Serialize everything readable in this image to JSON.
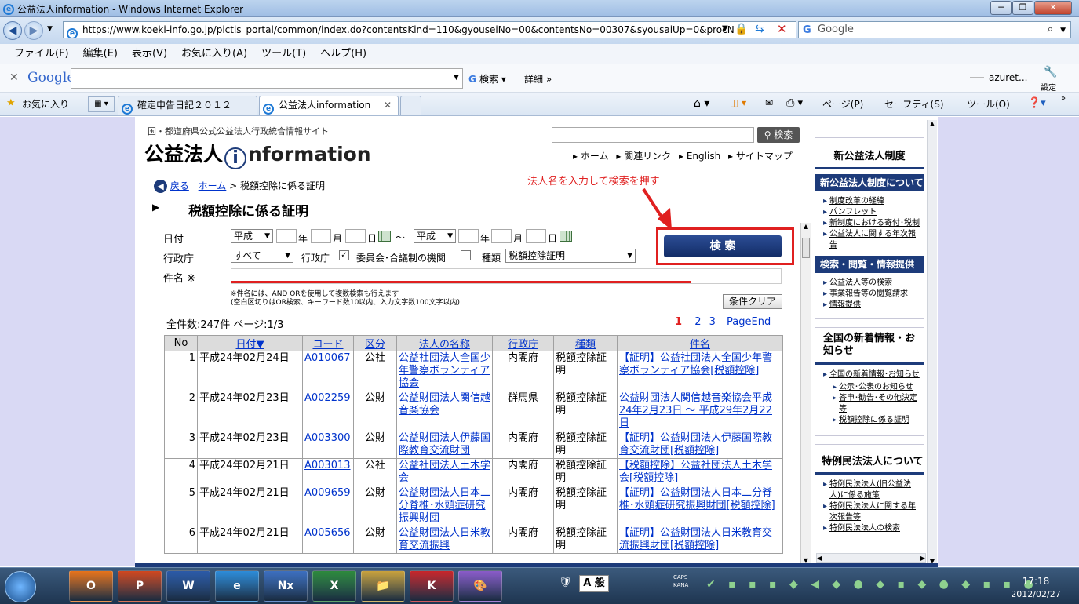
{
  "window": {
    "title": "公益法人information - Windows Internet Explorer",
    "min": "─",
    "max": "❐",
    "close": "✕"
  },
  "address": {
    "url": "https://www.koeki-info.go.jp/pictis_portal/common/index.do?contentsKind=110&gyouseiNo=00&contentsNo=00307&syousaiUp=0&procN",
    "search_engine": "Google"
  },
  "menu": [
    "ファイル(F)",
    "編集(E)",
    "表示(V)",
    "お気に入り(A)",
    "ツール(T)",
    "ヘルプ(H)"
  ],
  "gbar": {
    "logo": "Google",
    "search_btn": "検索",
    "details": "詳細 »",
    "user": "azuret...",
    "settings": "設定"
  },
  "favorites": {
    "label": "お気に入り"
  },
  "tabs": [
    "確定申告日記２０１２",
    "公益法人information"
  ],
  "cmdbar": [
    "ページ(P)",
    "セーフティ(S)",
    "ツール(O)"
  ],
  "site": {
    "subtitle": "国・都道府県公式公益法人行政統合情報サイト",
    "logo_a": "公益法人",
    "logo_i": "i",
    "logo_b": "nformation",
    "search_btn": "検索",
    "nav": [
      "ホーム",
      "関連リンク",
      "English",
      "サイトマップ"
    ],
    "back": "戻る",
    "crumb_home": "ホーム",
    "crumb_sep": ">",
    "crumb_current": "税額控除に係る証明",
    "annotation": "法人名を入力して検索を押す",
    "heading": "税額控除に係る証明"
  },
  "form": {
    "date_label": "日付",
    "era1": "平成",
    "era2": "平成",
    "year": "年",
    "month": "月",
    "day": "日",
    "tilde": "〜",
    "agency_label": "行政庁",
    "agency_value": "すべて",
    "agency_cb_label": "行政庁",
    "committee_label": "委員会･合議制の機関",
    "type_label": "種類",
    "type_value": "税額控除証明",
    "name_label": "件名 ※",
    "note1": "※件名には、AND ORを使用して複数検索も行えます",
    "note2": "(空白区切りはOR検索、キーワード数10以内、入力文字数100文字以内)",
    "search_btn": "検 索",
    "clear_btn": "条件クリア"
  },
  "results": {
    "count": "全件数:247件  ページ:1/3",
    "pages": [
      "1",
      "2",
      "3",
      "PageEnd"
    ],
    "headers": [
      "No",
      "日付▼",
      "コード",
      "区分",
      "法人の名称",
      "行政庁",
      "種類",
      "件名"
    ],
    "rows": [
      {
        "no": "1",
        "date": "平成24年02月24日",
        "code": "A010067",
        "kind": "公社",
        "name": "公益社団法人全国少年警察ボランティア協会",
        "agency": "内閣府",
        "type": "税額控除証明",
        "subject": "【証明】公益社団法人全国少年警察ボランティア協会[税額控除]"
      },
      {
        "no": "2",
        "date": "平成24年02月23日",
        "code": "A002259",
        "kind": "公財",
        "name": "公益財団法人関信越音楽協会",
        "agency": "群馬県",
        "type": "税額控除証明",
        "subject": "公益財団法人関信越音楽協会平成24年2月23日 〜 平成29年2月22日"
      },
      {
        "no": "3",
        "date": "平成24年02月23日",
        "code": "A003300",
        "kind": "公財",
        "name": "公益財団法人伊藤国際教育交流財団",
        "agency": "内閣府",
        "type": "税額控除証明",
        "subject": "【証明】公益財団法人伊藤国際教育交流財団[税額控除]"
      },
      {
        "no": "4",
        "date": "平成24年02月21日",
        "code": "A003013",
        "kind": "公社",
        "name": "公益社団法人土木学会",
        "agency": "内閣府",
        "type": "税額控除証明",
        "subject": "【税額控除】公益社団法人土木学会[税額控除]"
      },
      {
        "no": "5",
        "date": "平成24年02月21日",
        "code": "A009659",
        "kind": "公財",
        "name": "公益財団法人日本二分脊椎･水頭症研究振興財団",
        "agency": "内閣府",
        "type": "税額控除証明",
        "subject": "【証明】公益財団法人日本二分脊椎･水頭症研究振興財団[税額控除]"
      },
      {
        "no": "6",
        "date": "平成24年02月21日",
        "code": "A005656",
        "kind": "公財",
        "name": "公益財団法人日米教育交流振興",
        "agency": "内閣府",
        "type": "税額控除証明",
        "subject": "【証明】公益財団法人日米教育交流振興財団[税額控除]"
      }
    ]
  },
  "sidebar": {
    "title": "新公益法人制度",
    "sec1": "新公益法人制度について",
    "links1": [
      "制度改革の経緯",
      "パンフレット",
      "新制度における寄付･税制",
      "公益法人に関する年次報告"
    ],
    "sec2": "検索・閲覧・情報提供",
    "links2": [
      "公益法人等の検索",
      "事業報告等の閲覧請求",
      "情報提供"
    ],
    "sec3": "全国の新着情報・お知らせ",
    "links3": [
      "全国の新着情報･お知らせ"
    ],
    "links3b": [
      "公示･公表のお知らせ",
      "答申･勧告･その他決定等",
      "税額控除に係る証明"
    ],
    "sec4": "特例民法法人について",
    "links4": [
      "特例民法法人(旧公益法人)に係る施策",
      "特例民法法人に関する年次報告等",
      "特例民法法人の検索"
    ]
  },
  "taskbar": {
    "apps": [
      "O",
      "P",
      "W",
      "e",
      "Nx",
      "X",
      "📁",
      "K",
      "🎨"
    ],
    "ime": "A 般",
    "caps": "CAPS",
    "kana": "KANA",
    "time": "17:18",
    "date": "2012/02/27"
  },
  "colors": {
    "accent": "#1d3b7a",
    "annotation": "#e02020",
    "link": "#0033cc"
  }
}
